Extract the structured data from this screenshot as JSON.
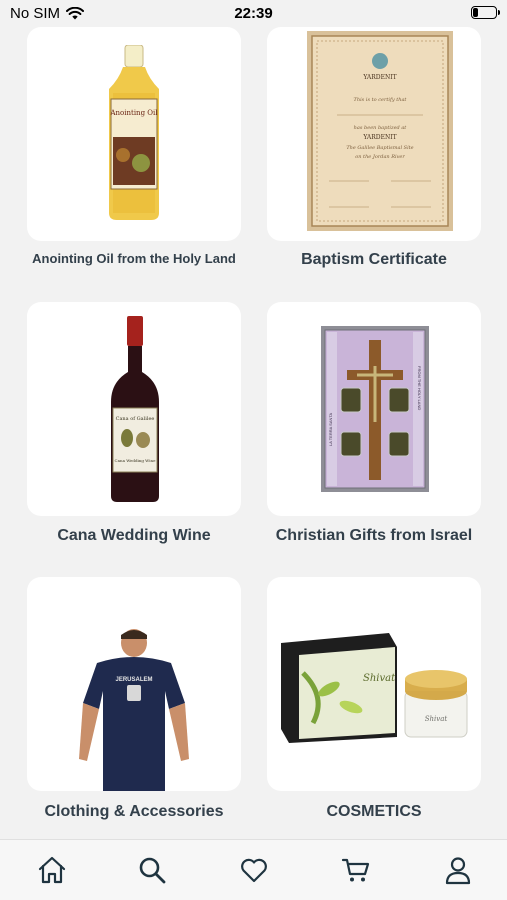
{
  "status_bar": {
    "carrier": "No SIM",
    "time": "22:39"
  },
  "categories": [
    {
      "label": "Anointing Oil from the Holy Land",
      "icon": "anointing-oil-image"
    },
    {
      "label": "Baptism Certificate",
      "icon": "baptism-certificate-image"
    },
    {
      "label": "Cana Wedding Wine",
      "icon": "wine-bottle-image"
    },
    {
      "label": "Christian Gifts from Israel",
      "icon": "crucifix-gift-set-image"
    },
    {
      "label": "Clothing & Accessories",
      "icon": "tshirt-model-image"
    },
    {
      "label": "COSMETICS",
      "icon": "cosmetics-jar-image"
    }
  ],
  "product_art": {
    "oil_title": "Anointing Oil",
    "cert_brand": "YARDENIT",
    "cert_line1": "This is to certify that",
    "cert_line2": "has been baptized at",
    "cert_line3": "The Galilee Baptismal Site",
    "cert_line4": "on the Jordan River",
    "wine_title": "Cana of Galilee",
    "wine_sub": "Cana Wedding Wine",
    "gift_side": "LA TERRA SANTA",
    "gift_top": "FROM THE HOLY LAND",
    "shirt_text": "JERUSALEM",
    "cosm_brand": "Shivat"
  },
  "tab_bar": {
    "items": [
      "home-icon",
      "search-icon",
      "heart-icon",
      "cart-icon",
      "profile-icon"
    ]
  },
  "colors": {
    "background": "#f2f2f2",
    "card": "#ffffff",
    "text": "#33404b",
    "icons": "#1f3440"
  }
}
